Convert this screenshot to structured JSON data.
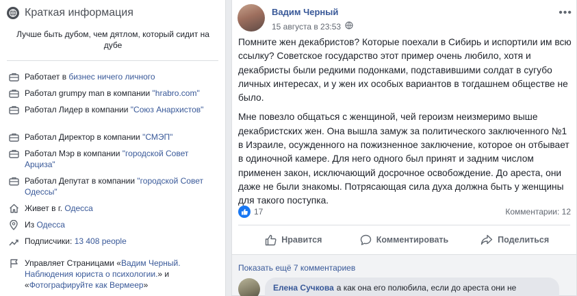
{
  "intro": {
    "title": "Краткая информация",
    "bio": "Лучше быть дубом, чем дятлом, который сидит на дубе",
    "items": [
      {
        "pre": "Работает в ",
        "link": "бизнес ничего личного",
        "icon": "briefcase-icon"
      },
      {
        "pre": "Работал grumpy man в компании ",
        "link": "\"hrabro.com\"",
        "icon": "briefcase-icon"
      },
      {
        "pre": "Работал Лидер в компании ",
        "link": "\"Союз Анархистов\"",
        "icon": "briefcase-icon"
      },
      {
        "pre": "Работал Директор в компании ",
        "link": "\"СМЭП\"",
        "icon": "briefcase-icon"
      },
      {
        "pre": "Работал Мэр в компании ",
        "link": "\"городской Совет Арциза\"",
        "icon": "briefcase-icon"
      },
      {
        "pre": "Работал Депутат в компании ",
        "link": "\"городской Совет Одессы\"",
        "icon": "briefcase-icon"
      },
      {
        "pre": "Живет в г. ",
        "link": "Одесса",
        "icon": "home-icon"
      },
      {
        "pre": "Из ",
        "link": "Одесса",
        "icon": "location-pin-icon"
      },
      {
        "pre": "Подписчики: ",
        "link": "13 408 people",
        "icon": "followers-icon"
      }
    ],
    "pages": {
      "pre": "Управляет Страницами «",
      "link1": "Вадим Черный. Наблюдения юриста о психологии.",
      "mid": "» и «",
      "link2": "Фотографируйте как Вермеер",
      "post": "»"
    }
  },
  "post": {
    "author": "Вадим Черный",
    "date": "15 августа в 23:53",
    "more_label": "•••",
    "paragraphs": [
      "Помните жен декабристов? Которые поехали в Сибирь и испортили им всю ссылку? Советское государство этот пример очень любило, хотя и декабристы были редкими подонками, подставившими солдат в сугубо личных интересах, и у жен их особых вариантов в тогдашнем обществе не было.",
      "Мне повезло общаться с женщиной, чей героизм неизмеримо выше декабристских жен. Она вышла замуж за политического заключенного №1 в Израиле, осужденного на пожизненное заключение, которое он отбывает в одиночной камере. Для него одного был принят и задним числом применен закон, исключающий досрочное освобождение. До ареста, они даже не были знакомы. Потрясающая сила духа должна быть у женщины для такого поступка."
    ],
    "reactions": "17",
    "comments_count": "Комментарии: 12",
    "actions": {
      "like": "Нравится",
      "comment": "Комментировать",
      "share": "Поделиться"
    }
  },
  "comments": {
    "show_more": "Показать ещё 7 комментариев",
    "first": {
      "author": "Елена Сучкова",
      "text": "а как она его полюбила, если до ареста они не"
    }
  },
  "colors": {
    "link": "#385898",
    "like_blue": "#1877f2",
    "page_bg": "#e9ebee"
  }
}
